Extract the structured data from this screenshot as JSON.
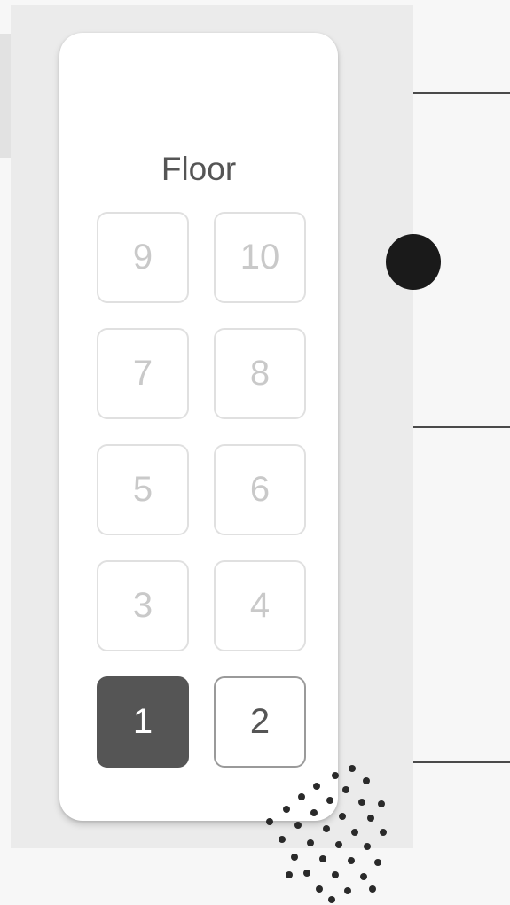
{
  "panel": {
    "title": "Floor"
  },
  "buttons": [
    {
      "label": "9",
      "state": "disabled"
    },
    {
      "label": "10",
      "state": "disabled"
    },
    {
      "label": "7",
      "state": "disabled"
    },
    {
      "label": "8",
      "state": "disabled"
    },
    {
      "label": "5",
      "state": "disabled"
    },
    {
      "label": "6",
      "state": "disabled"
    },
    {
      "label": "3",
      "state": "disabled"
    },
    {
      "label": "4",
      "state": "disabled"
    },
    {
      "label": "1",
      "state": "current"
    },
    {
      "label": "2",
      "state": "available"
    }
  ],
  "current_floor": "1",
  "colors": {
    "panel": "#ffffff",
    "backdrop": "#ebebeb",
    "current_button": "#555555",
    "disabled_text": "#c9c9c9",
    "marker": "#1a1a1a"
  },
  "icons": {
    "marker": "filled-circle",
    "decoration": "dot-pattern"
  }
}
